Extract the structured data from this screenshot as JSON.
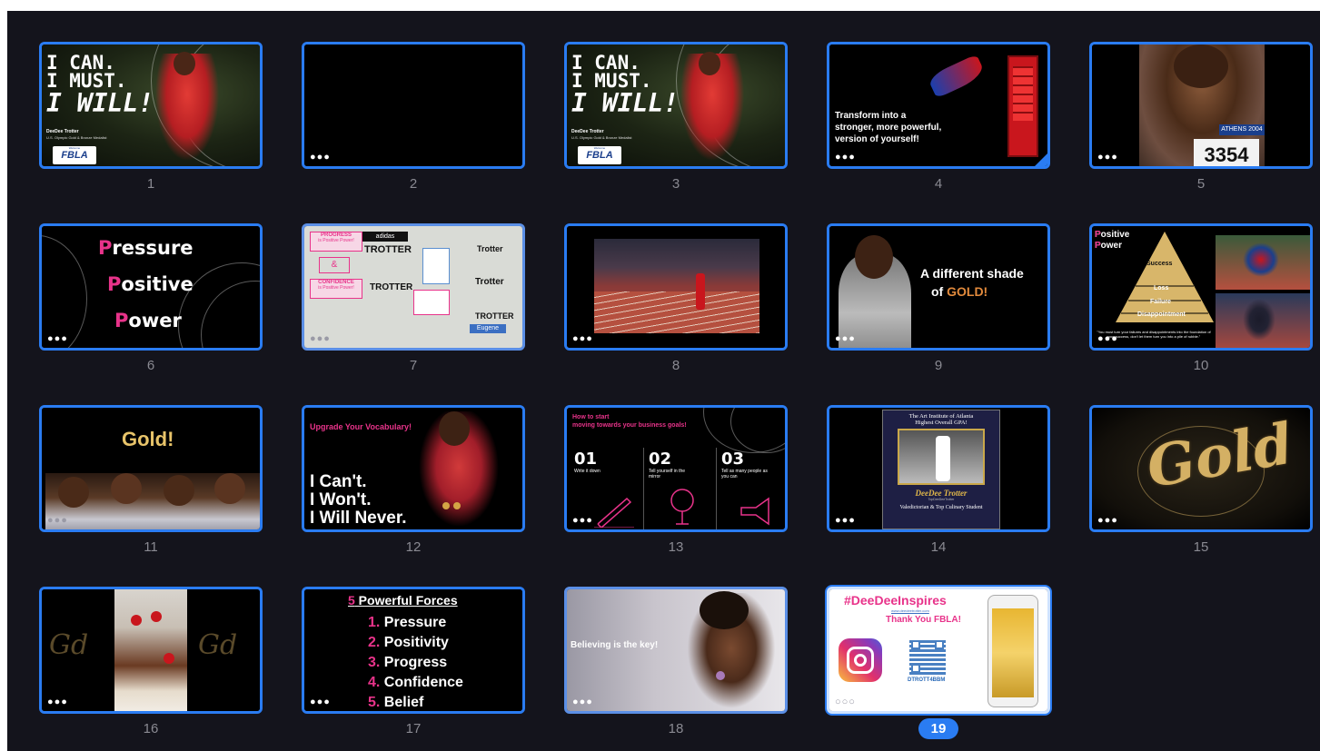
{
  "selected_slide": 19,
  "slides": [
    {
      "n": "1",
      "title_lines": [
        "I CAN.",
        "I MUST.",
        "I WILL!"
      ],
      "caption": "DeeDee Trotter",
      "subcaption": "U.S. Olympic Gold & Bronze Medalist",
      "badge_small": "Welcome",
      "badge": "FBLA"
    },
    {
      "n": "2"
    },
    {
      "n": "3",
      "title_lines": [
        "I CAN.",
        "I MUST.",
        "I WILL!"
      ],
      "caption": "DeeDee Trotter",
      "subcaption": "U.S. Olympic Gold & Bronze Medalist",
      "badge_small": "Welcome",
      "badge": "FBLA"
    },
    {
      "n": "4",
      "lines": [
        "Transform into a",
        "stronger, more powerful,",
        "version of yourself!"
      ]
    },
    {
      "n": "5",
      "bib": "3354",
      "banner": "ATHENS 2004"
    },
    {
      "n": "6",
      "words": [
        {
          "first": "P",
          "rest": "ressure"
        },
        {
          "first": "P",
          "rest": "ositive"
        },
        {
          "first": "P",
          "rest": "ower"
        }
      ]
    },
    {
      "n": "7",
      "labels": [
        "PROGRESS",
        "is Positive Power!",
        "&",
        "CONFIDENCE",
        "is Positive Power!"
      ],
      "brands": [
        "adidas",
        "TROTTER",
        "Trotter",
        "TROTTER",
        "Trotter",
        "TROTTER",
        "Eugene"
      ]
    },
    {
      "n": "8"
    },
    {
      "n": "9",
      "line1": "A different shade",
      "line2_pre": "of ",
      "line2_gold": "GOLD!"
    },
    {
      "n": "10",
      "title_lines": [
        "Positive",
        "Power"
      ],
      "pyramid": [
        "Success",
        "Loss",
        "Failure",
        "Disappointment"
      ],
      "quote": "\"You must turn your failures and disappointments into the foundation of your success, don't let them turn you into a pile of rubble.\""
    },
    {
      "n": "11",
      "title": "Gold!"
    },
    {
      "n": "12",
      "heading": "Upgrade Your Vocabulary!",
      "lines": [
        "I Can't.",
        "I Won't.",
        "I Will Never."
      ]
    },
    {
      "n": "13",
      "heading_lines": [
        "How to start",
        "moving towards your business goals!"
      ],
      "steps": [
        {
          "num": "01",
          "text": "Write it down"
        },
        {
          "num": "02",
          "text": "Tell yourself in the mirror"
        },
        {
          "num": "03",
          "text": "Tell as many people as you can"
        }
      ]
    },
    {
      "n": "14",
      "lines_top": [
        "The Art Institute of Atlanta",
        "Highest Overall GPA!"
      ],
      "name": "DeeDee Trotter",
      "small": "TopDeeDeeTrotter",
      "bottom": "Valedictorian & Top Culinary Student"
    },
    {
      "n": "15",
      "script_text": "Gold"
    },
    {
      "n": "16"
    },
    {
      "n": "17",
      "heading_num": "5",
      "heading_text": " Powerful Forces",
      "items": [
        {
          "num": "1.",
          "text": " Pressure"
        },
        {
          "num": "2.",
          "text": " Positivity"
        },
        {
          "num": "3.",
          "text": " Progress"
        },
        {
          "num": "4.",
          "text": " Confidence"
        },
        {
          "num": "5.",
          "text": " Belief"
        }
      ]
    },
    {
      "n": "18",
      "text": "Believing is the key!"
    },
    {
      "n": "19",
      "hashtag": "#DeeDeeInspires",
      "url": "www.deedeetrotter.com",
      "thanks": "Thank You FBLA!",
      "handle": "DTROTT4BBM"
    }
  ],
  "more_icon": "ellipsis-icon",
  "colors": {
    "background": "#14141c",
    "accent": "#2a7cf2",
    "pink": "#e8338a",
    "gold": "#e8c46a"
  }
}
